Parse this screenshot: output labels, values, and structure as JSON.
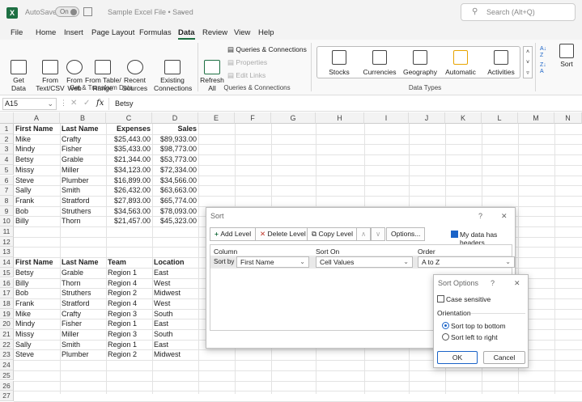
{
  "titlebar": {
    "logo": "X",
    "autosave_label": "AutoSave",
    "autosave_state": "On",
    "file_title": "Sample Excel File • Saved",
    "search_placeholder": "Search (Alt+Q)"
  },
  "menu": [
    "File",
    "Home",
    "Insert",
    "Page Layout",
    "Formulas",
    "Data",
    "Review",
    "View",
    "Help"
  ],
  "active_menu": "Data",
  "ribbon": {
    "get_data": "Get\nData",
    "from_text": "From\nText/CSV",
    "from_web": "From\nWeb",
    "from_table": "From Table/\nRange",
    "recent": "Recent\nSources",
    "existing": "Existing\nConnections",
    "group_get": "Get & Transform Data",
    "refresh": "Refresh\nAll",
    "queries": "Queries & Connections",
    "properties": "Properties",
    "edit_links": "Edit Links",
    "group_queries": "Queries & Connections",
    "data_types": [
      "Stocks",
      "Currencies",
      "Geography",
      "Automatic",
      "Activities"
    ],
    "group_types": "Data Types",
    "sort": "Sort"
  },
  "formula": {
    "namebox": "A15",
    "fx": "fx",
    "value": "Betsy"
  },
  "columns": [
    "A",
    "B",
    "C",
    "D",
    "E",
    "F",
    "G",
    "H",
    "I",
    "J",
    "K",
    "L",
    "M",
    "N"
  ],
  "rows": [
    [
      "First Name",
      "Last Name",
      "Expenses",
      "Sales"
    ],
    [
      "Mike",
      "Crafty",
      "$25,443.00",
      "$89,933.00"
    ],
    [
      "Mindy",
      "Fisher",
      "$35,433.00",
      "$98,773.00"
    ],
    [
      "Betsy",
      "Grable",
      "$21,344.00",
      "$53,773.00"
    ],
    [
      "Missy",
      "Miller",
      "$34,123.00",
      "$72,334.00"
    ],
    [
      "Steve",
      "Plumber",
      "$16,899.00",
      "$34,566.00"
    ],
    [
      "Sally",
      "Smith",
      "$26,432.00",
      "$63,663.00"
    ],
    [
      "Frank",
      "Stratford",
      "$27,893.00",
      "$65,774.00"
    ],
    [
      "Bob",
      "Struthers",
      "$34,563.00",
      "$78,093.00"
    ],
    [
      "Billy",
      "Thorn",
      "$21,457.00",
      "$45,323.00"
    ],
    [
      "",
      "",
      "",
      ""
    ],
    [
      "",
      "",
      "",
      ""
    ],
    [
      "",
      "",
      "",
      ""
    ],
    [
      "First Name",
      "Last Name",
      "Team",
      "Location"
    ],
    [
      "Betsy",
      "Grable",
      "Region 1",
      "East"
    ],
    [
      "Billy",
      "Thorn",
      "Region 4",
      "West"
    ],
    [
      "Bob",
      "Struthers",
      "Region 2",
      "Midwest"
    ],
    [
      "Frank",
      "Stratford",
      "Region 4",
      "West"
    ],
    [
      "Mike",
      "Crafty",
      "Region 3",
      "South"
    ],
    [
      "Mindy",
      "Fisher",
      "Region 1",
      "East"
    ],
    [
      "Missy",
      "Miller",
      "Region 3",
      "South"
    ],
    [
      "Sally",
      "Smith",
      "Region 1",
      "East"
    ],
    [
      "Steve",
      "Plumber",
      "Region 2",
      "Midwest"
    ],
    [
      "",
      "",
      "",
      ""
    ],
    [
      "",
      "",
      "",
      ""
    ],
    [
      "",
      "",
      "",
      ""
    ],
    [
      "",
      "",
      "",
      ""
    ]
  ],
  "sort_dialog": {
    "title": "Sort",
    "help": "?",
    "close": "✕",
    "add_level": "Add Level",
    "delete_level": "Delete Level",
    "copy_level": "Copy Level",
    "up": "∧",
    "down": "∨",
    "options": "Options...",
    "headers_label": "My data has headers",
    "col_header": "Column",
    "sorton_header": "Sort On",
    "order_header": "Order",
    "sort_by": "Sort by",
    "column_value": "First Name",
    "sorton_value": "Cell Values",
    "order_value": "A to Z"
  },
  "options_dialog": {
    "title": "Sort Options",
    "help": "?",
    "close": "✕",
    "case_sensitive": "Case sensitive",
    "orientation": "Orientation",
    "top_bottom": "Sort top to bottom",
    "left_right": "Sort left to right",
    "ok": "OK",
    "cancel": "Cancel"
  }
}
